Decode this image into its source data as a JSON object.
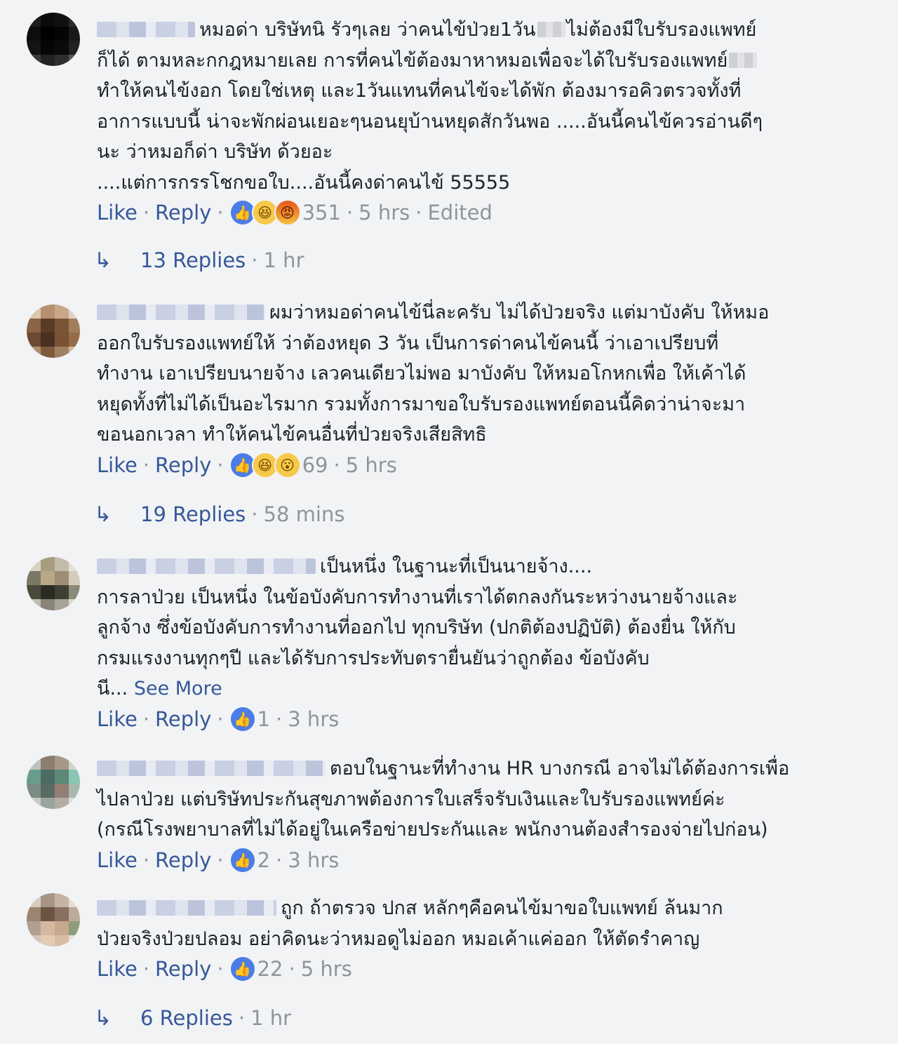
{
  "comments": [
    {
      "text_lines": [
        "หมอด่า บริษัทนิ รัวๆเลย ว่าคนไข้ป่วย1วัน",
        "ไม่ต้องมีใบรับรองแพทย์",
        "ก็ได้ ตามหละกกฎหมายเลย การที่คนไข้ต้องมาหาหมอเพื่อจะได้ใบรับรองแพทย์",
        "ทำให้คนไข้งอก โดยใช่เหตุ และ1วันแทนที่คนไข้จะได้พัก ต้องมารอคิวตรวจทั้งที่",
        "อาการแบบนี้ น่าจะพักผ่อนเยอะๆนอนยุบ้านหยุดสักวันพอ .....อันนี้คนไข้ควรอ่านดีๆ",
        "นะ ว่าหมอก็ด่า บริษัท ด้วยอะ",
        "....แต่การกรรโชกขอใบ....อันนี้คงด่าคนไข้ 55555"
      ],
      "like_label": "Like",
      "reply_label": "Reply",
      "reactions": [
        "like-icon",
        "haha-icon",
        "angry-icon"
      ],
      "count": "351",
      "time": "5 hrs",
      "edited": "Edited",
      "replies_label": "13 Replies",
      "replies_time": "1 hr"
    },
    {
      "text_lines": [
        "ผมว่าหมอด่าคนไข้นี่ละครับ ไม่ได้ป่วยจริง แต่มาบังคับ ให้หมอ",
        "ออกใบรับรองแพทย์ให้ ว่าต้องหยุด 3 วัน เป็นการด่าคนไข้คนนี้ ว่าเอาเปรียบที่",
        "ทำงาน เอาเปรียบนายจ้าง เลวคนเดียวไม่พอ มาบังคับ ให้หมอโกหกเพื่อ ให้เค้าได้",
        "หยุดทั้งที่ไม่ได้เป็นอะไรมาก รวมทั้งการมาขอใบรับรองแพทย์ตอนนี้คิดว่าน่าจะมา",
        "ขอนอกเวลา ทำให้คนไข้คนอื่นที่ป่วยจริงเสียสิทธิ"
      ],
      "like_label": "Like",
      "reply_label": "Reply",
      "reactions": [
        "like-icon",
        "haha-icon",
        "wow-icon"
      ],
      "count": "69",
      "time": "5 hrs",
      "replies_label": "19 Replies",
      "replies_time": "58 mins"
    },
    {
      "text_lines": [
        "เป็นหนึ่ง ในฐานะที่เป็นนายจ้าง....",
        "การลาป่วย เป็นหนึ่ง ในข้อบังคับการทำงานที่เราได้ตกลงกันระหว่างนายจ้างและ",
        "ลูกจ้าง ซึ่งข้อบังคับการทำงานที่ออกไป ทุกบริษัท (ปกติต้องปฏิบัติ) ต้องยื่น ให้กับ",
        "กรมแรงงานทุกๆปี และได้รับการประทับตรายื่นยันว่าถูกต้อง ข้อบังคับ",
        "นี..."
      ],
      "see_more": "See More",
      "like_label": "Like",
      "reply_label": "Reply",
      "reactions": [
        "like-icon"
      ],
      "count": "1",
      "time": "3 hrs"
    },
    {
      "text_lines": [
        "ตอบในฐานะที่ทำงาน HR บางกรณี อาจไม่ได้ต้องการเพื่อ",
        "ไปลาป่วย แต่บริษัทประกันสุขภาพต้องการใบเสร็จรับเงินและใบรับรองแพทย์ค่ะ",
        "(กรณีโรงพยาบาลที่ไม่ได้อยู่ในเครือข่ายประกันและ พนักงานต้องสำรองจ่ายไปก่อน)"
      ],
      "like_label": "Like",
      "reply_label": "Reply",
      "reactions": [
        "like-icon"
      ],
      "count": "2",
      "time": "3 hrs"
    },
    {
      "text_lines": [
        "ถูก ถ้าตรวจ ปกส หลักๆคือคนไข้มาขอใบแพทย์ ล้นมาก",
        "ป่วยจริงป่วยปลอม อย่าคิดนะว่าหมอดูไม่ออก หมอเค้าแค่ออก ให้ตัดรำคาญ"
      ],
      "like_label": "Like",
      "reply_label": "Reply",
      "reactions": [
        "like-icon"
      ],
      "count": "22",
      "time": "5 hrs",
      "replies_label": "6 Replies",
      "replies_time": "1 hr"
    }
  ],
  "colors": {
    "background": "#f2f3f5",
    "link": "#365899",
    "meta": "#90949c",
    "text": "#1d2129",
    "like_reaction": "#4a7de8"
  },
  "icons": {
    "reply_arrow": "reply-arrow-icon"
  }
}
